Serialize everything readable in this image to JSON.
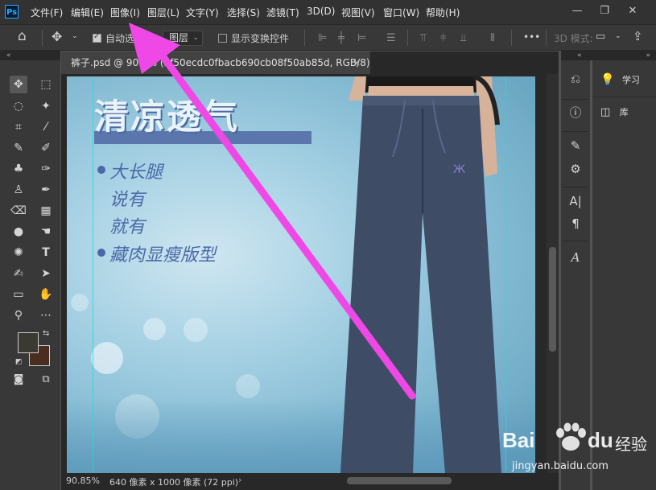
{
  "app": {
    "logo_text": "Ps"
  },
  "menu": {
    "items": [
      "文件(F)",
      "编辑(E)",
      "图像(I)",
      "图层(L)",
      "文字(Y)",
      "选择(S)",
      "滤镜(T)",
      "3D(D)",
      "视图(V)",
      "窗口(W)",
      "帮助(H)"
    ]
  },
  "window_controls": {
    "minimize": "—",
    "restore": "❐",
    "close": "✕"
  },
  "options_bar": {
    "auto_select_label": "自动选",
    "auto_select_checked": true,
    "layer_dropdown": "图层",
    "show_transform_label": "显示变换控件",
    "mode_3d_label": "3D 模式:",
    "more_label": "•••"
  },
  "document": {
    "tab_title": "裤子.psd @ 90.8% (5f50ecdc0fbacb690cb08f50ab85d, RGB/8)",
    "tab_close": "×"
  },
  "artwork": {
    "headline": "清凉透气",
    "bullets": [
      "大长腿",
      "说有",
      "就有",
      "藏肉显瘦版型"
    ]
  },
  "status": {
    "zoom": "90.85%",
    "doc_info": "640 像素 x 1000 像素 (72 ppi)"
  },
  "right_panel": {
    "items": [
      {
        "icon": "lightbulb-icon",
        "label": "学习"
      },
      {
        "icon": "library-icon",
        "label": "库"
      }
    ]
  },
  "watermark": {
    "brand": "Bai",
    "brand2": "du",
    "suffix": "经验",
    "url": "jingyan.baidu.com"
  },
  "colors": {
    "menubar": "#323232",
    "panel": "#383838",
    "accent_arrow": "#ef48e6",
    "foreground_swatch": "#3a3a32",
    "background_swatch": "#4a2d1e",
    "headline_fill": "#e9f3fa",
    "headline_band": "#5a76ad",
    "bullet_text": "#4a68a8",
    "baidu_blue": "#2932e1",
    "baidu_red": "#e10602"
  }
}
